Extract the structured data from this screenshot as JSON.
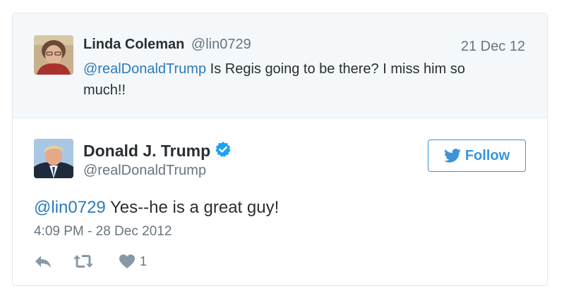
{
  "reply_context": {
    "name": "Linda Coleman",
    "handle": "@lin0729",
    "date": "21 Dec 12",
    "mention": "@realDonaldTrump",
    "text": " Is Regis going to be there? I miss him so much!!"
  },
  "tweet": {
    "author_name": "Donald J. Trump",
    "author_handle": "@realDonaldTrump",
    "follow_label": "Follow",
    "mention": "@lin0729",
    "text": " Yes--he is a great guy!",
    "timestamp": "4:09 PM - 28 Dec 2012",
    "like_count": "1"
  },
  "icons": {
    "verified": "verified-badge-icon",
    "follow": "twitter-bird-icon",
    "reply": "reply-icon",
    "retweet": "retweet-icon",
    "like": "heart-icon"
  },
  "colors": {
    "link": "#2b7bb9",
    "follow_accent": "#3b94d9",
    "verified": "#1da1f2",
    "muted": "#66757f",
    "text": "#292f33",
    "context_bg": "#f5f8fa"
  }
}
